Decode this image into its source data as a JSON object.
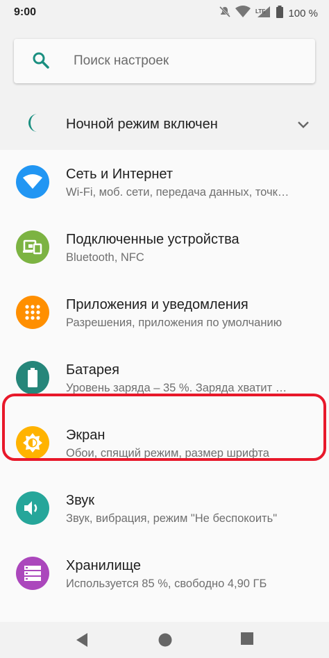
{
  "status_bar": {
    "time": "9:00",
    "battery": "100 %",
    "icons": [
      "mute-icon",
      "wifi-icon",
      "lte-signal-icon",
      "battery-icon"
    ]
  },
  "search": {
    "placeholder": "Поиск настроек"
  },
  "night_mode": {
    "label": "Ночной режим включен"
  },
  "settings": {
    "items": [
      {
        "title": "Сеть и Интернет",
        "subtitle": "Wi-Fi, моб. сети, передача данных, точк…",
        "icon": "wifi-icon",
        "color": "#2196f3"
      },
      {
        "title": "Подключенные устройства",
        "subtitle": "Bluetooth, NFC",
        "icon": "devices-icon",
        "color": "#7cb342"
      },
      {
        "title": "Приложения и уведомления",
        "subtitle": "Разрешения, приложения по умолчанию",
        "icon": "apps-icon",
        "color": "#ff8f00"
      },
      {
        "title": "Батарея",
        "subtitle": "Уровень заряда – 35 %. Заряда хватит …",
        "icon": "battery-icon",
        "color": "#26867a"
      },
      {
        "title": "Экран",
        "subtitle": "Обои, спящий режим, размер шрифта",
        "icon": "brightness-icon",
        "color": "#ffb300"
      },
      {
        "title": "Звук",
        "subtitle": "Звук, вибрация, режим \"Не беспокоить\"",
        "icon": "volume-icon",
        "color": "#26a69a"
      },
      {
        "title": "Хранилище",
        "subtitle": "Используется 85 %, свободно 4,90 ГБ",
        "icon": "storage-icon",
        "color": "#ab47bc"
      }
    ]
  },
  "highlight_color": "#e8182a"
}
